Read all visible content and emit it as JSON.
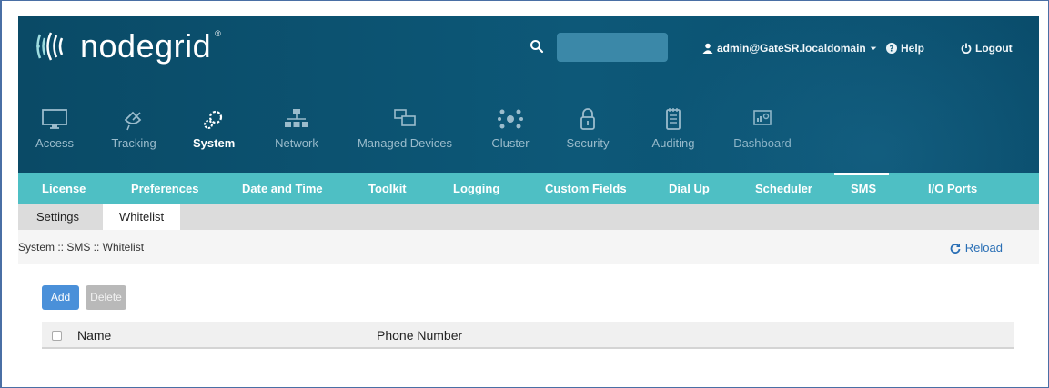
{
  "header": {
    "logo_text": "nodegrid",
    "logo_reg": "®",
    "search": {
      "placeholder": "",
      "icon": "search-icon"
    },
    "user_menu": "admin@GateSR.localdomain",
    "help": "Help",
    "logout": "Logout"
  },
  "main_nav": [
    {
      "label": "Access",
      "icon": "monitor-icon",
      "active": false
    },
    {
      "label": "Tracking",
      "icon": "satellite-icon",
      "active": false
    },
    {
      "label": "System",
      "icon": "gears-icon",
      "active": true
    },
    {
      "label": "Network",
      "icon": "network-icon",
      "active": false
    },
    {
      "label": "Managed Devices",
      "icon": "devices-icon",
      "active": false
    },
    {
      "label": "Cluster",
      "icon": "cluster-icon",
      "active": false
    },
    {
      "label": "Security",
      "icon": "lock-icon",
      "active": false
    },
    {
      "label": "Auditing",
      "icon": "notepad-icon",
      "active": false
    },
    {
      "label": "Dashboard",
      "icon": "dashboard-icon",
      "active": false
    }
  ],
  "sub_nav": [
    {
      "label": "License",
      "active": false
    },
    {
      "label": "Preferences",
      "active": false
    },
    {
      "label": "Date and Time",
      "active": false
    },
    {
      "label": "Toolkit",
      "active": false
    },
    {
      "label": "Logging",
      "active": false
    },
    {
      "label": "Custom Fields",
      "active": false
    },
    {
      "label": "Dial Up",
      "active": false
    },
    {
      "label": "Scheduler",
      "active": false
    },
    {
      "label": "SMS",
      "active": true
    },
    {
      "label": "I/O Ports",
      "active": false
    }
  ],
  "tabs": [
    {
      "label": "Settings",
      "active": false
    },
    {
      "label": "Whitelist",
      "active": true
    }
  ],
  "breadcrumb": "System :: SMS :: Whitelist",
  "reload": "Reload",
  "actions": {
    "add": "Add",
    "delete": "Delete"
  },
  "table": {
    "columns": [
      "Name",
      "Phone Number"
    ],
    "rows": []
  },
  "colors": {
    "header": "#0d5878",
    "subnav": "#4ebfc4",
    "add_button": "#4a90d9",
    "link": "#2a6fb5"
  }
}
